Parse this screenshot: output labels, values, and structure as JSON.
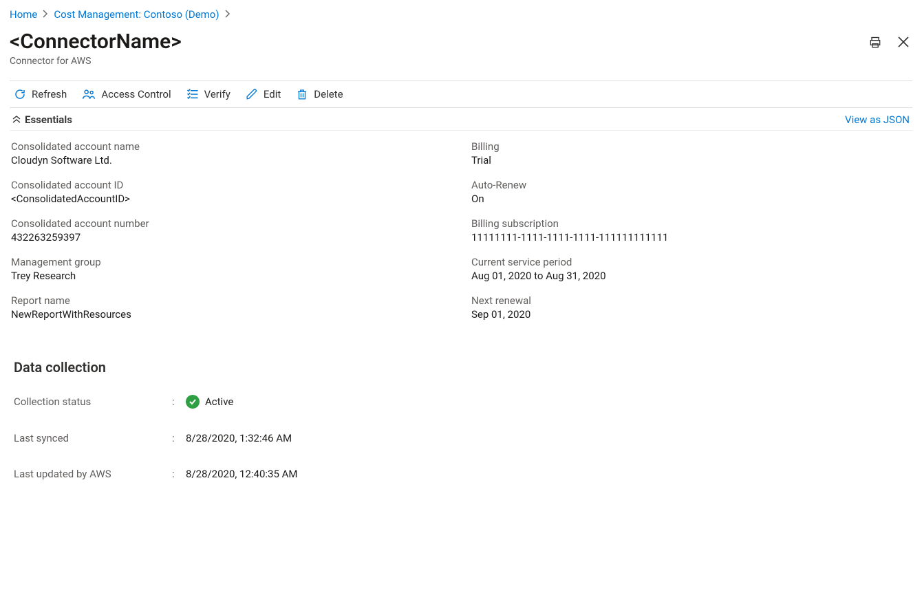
{
  "breadcrumb": {
    "home": "Home",
    "cost_mgmt": "Cost Management: Contoso (Demo)"
  },
  "header": {
    "title": "<ConnectorName>",
    "subtitle": "Connector for AWS"
  },
  "toolbar": {
    "refresh": "Refresh",
    "access_control": "Access Control",
    "verify": "Verify",
    "edit": "Edit",
    "delete": "Delete"
  },
  "essentials_bar": {
    "label": "Essentials",
    "view_json": "View as JSON"
  },
  "essentials": {
    "left": [
      {
        "label": "Consolidated account name",
        "value": "Cloudyn Software Ltd.",
        "link": true
      },
      {
        "label": "Consolidated account ID",
        "value": "<ConsolidatedAccountID>",
        "link": false
      },
      {
        "label": "Consolidated account number",
        "value": "432263259397",
        "link": false
      },
      {
        "label": "Management group",
        "value": "Trey Research",
        "link": false
      },
      {
        "label": "Report name",
        "value": "NewReportWithResources",
        "link": false
      }
    ],
    "right": [
      {
        "label": "Billing",
        "value": "Trial",
        "link": false
      },
      {
        "label": "Auto-Renew",
        "value": "On",
        "link": true
      },
      {
        "label": "Billing subscription",
        "value": "11111111-1111-1111-1111-111111111111",
        "link": false
      },
      {
        "label": "Current service period",
        "value": "Aug 01, 2020 to Aug 31, 2020",
        "link": false
      },
      {
        "label": "Next renewal",
        "value": "Sep 01, 2020",
        "link": false
      }
    ]
  },
  "data_collection": {
    "title": "Data collection",
    "rows": {
      "status_label": "Collection status",
      "status_value": "Active",
      "last_synced_label": "Last synced",
      "last_synced_value": "8/28/2020, 1:32:46 AM",
      "last_updated_label": "Last updated by AWS",
      "last_updated_value": "8/28/2020, 12:40:35 AM"
    }
  }
}
